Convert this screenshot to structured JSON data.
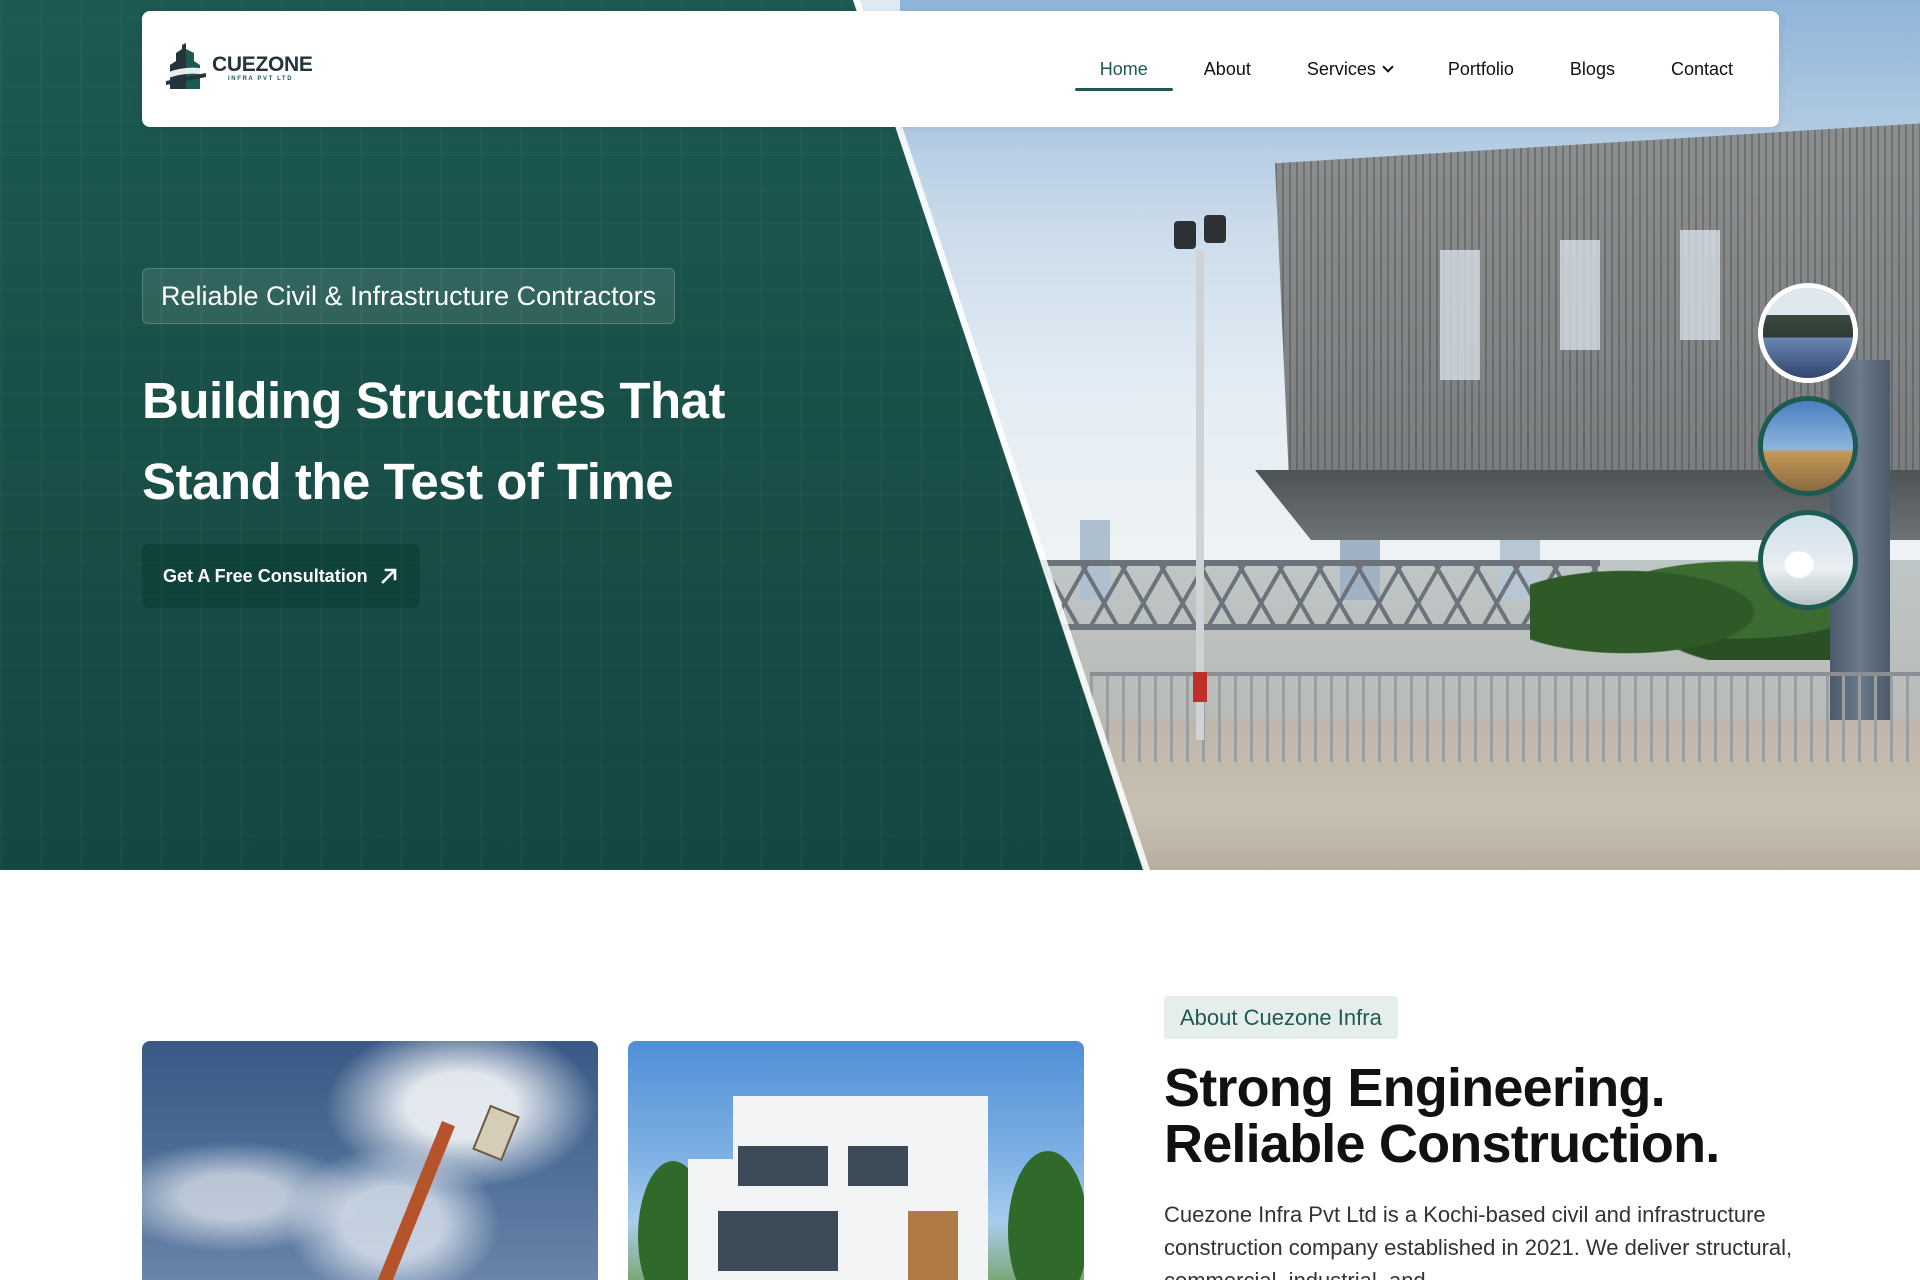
{
  "nav": {
    "logo": {
      "name": "CUEZONE",
      "sub": "INFRA PVT LTD"
    },
    "items": [
      {
        "label": "Home",
        "active": true
      },
      {
        "label": "About"
      },
      {
        "label": "Services",
        "has_dropdown": true
      },
      {
        "label": "Portfolio"
      },
      {
        "label": "Blogs"
      },
      {
        "label": "Contact"
      }
    ]
  },
  "hero": {
    "badge": "Reliable Civil & Infrastructure Contractors",
    "title_line1": "Building Structures That",
    "title_line2": "Stand the Test of Time",
    "cta_label": "Get A Free Consultation",
    "cta_icon": "arrow-up-right-icon",
    "thumbnails": [
      {
        "name": "bridge-thumbnail",
        "active": true
      },
      {
        "name": "construction-site-thumbnail",
        "active": false
      },
      {
        "name": "engineer-thumbnail",
        "active": false
      }
    ]
  },
  "about": {
    "badge": "About Cuezone Infra",
    "title_line1": "Strong Engineering.",
    "title_line2": "Reliable Construction.",
    "paragraph": "Cuezone Infra Pvt Ltd is a Kochi-based civil and infrastructure construction company established in 2021. We deliver structural, commercial, industrial, and"
  },
  "colors": {
    "brand_green": "#1d5a52",
    "white": "#ffffff",
    "text_dark": "#111111"
  }
}
